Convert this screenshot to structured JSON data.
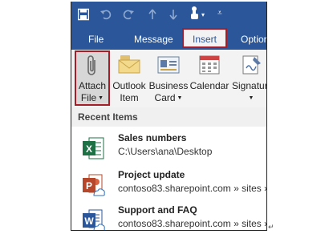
{
  "quick_access": {
    "icons": [
      "save-icon",
      "undo-icon",
      "redo-icon",
      "up-icon",
      "down-icon",
      "touch-mode-icon",
      "customize-icon"
    ]
  },
  "tabs": [
    {
      "label": "File"
    },
    {
      "label": "Message"
    },
    {
      "label": "Insert"
    },
    {
      "label": "Optior"
    }
  ],
  "ribbon": {
    "attach": {
      "line1": "Attach",
      "line2": "File"
    },
    "outlook_item": {
      "line1": "Outlook",
      "line2": "Item"
    },
    "business_card": {
      "line1": "Business",
      "line2": "Card"
    },
    "calendar": {
      "line1": "Calendar"
    },
    "signature": {
      "line1": "Signature"
    }
  },
  "recent": {
    "header": "Recent Items",
    "items": [
      {
        "name": "Sales numbers",
        "path": "C:\\Users\\ana\\Desktop",
        "icon": "excel-file-icon"
      },
      {
        "name": "Project update",
        "path": "contoso83.sharepoint.com » sites »",
        "icon": "powerpoint-file-icon"
      },
      {
        "name": "Support and FAQ",
        "path": "contoso83.sharepoint.com » sites »",
        "icon": "word-file-icon"
      }
    ]
  },
  "colors": {
    "title_bar": "#2b579a",
    "highlight": "#a51d26",
    "ribbon_bg": "#f3f3f3"
  },
  "paragraph_mark": "↵"
}
